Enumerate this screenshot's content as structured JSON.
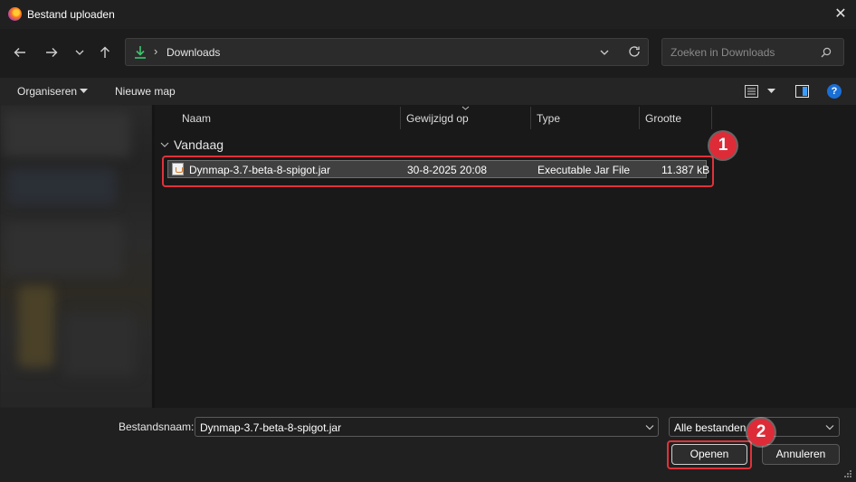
{
  "window": {
    "title": "Bestand uploaden",
    "close_icon": "close-icon",
    "app_icon": "firefox-icon"
  },
  "nav": {
    "back_icon": "arrow-left-icon",
    "forward_icon": "arrow-right-icon",
    "recent_icon": "chevron-down-icon",
    "up_icon": "arrow-up-icon"
  },
  "address": {
    "folder_icon": "download-icon",
    "separator": "›",
    "location": "Downloads"
  },
  "search": {
    "placeholder": "Zoeken in Downloads"
  },
  "toolbar": {
    "organize_label": "Organiseren",
    "new_folder_label": "Nieuwe map"
  },
  "columns": [
    "Naam",
    "Gewijzigd op",
    "Type",
    "Grootte"
  ],
  "group": {
    "label": "Vandaag"
  },
  "files": [
    {
      "name": "Dynmap-3.7-beta-8-spigot.jar",
      "modified": "30-8-2025 20:08",
      "type": "Executable Jar File",
      "size": "11.387 kB"
    }
  ],
  "footer": {
    "filename_label": "Bestandsnaam:",
    "filename_value": "Dynmap-3.7-beta-8-spigot.jar",
    "filter_value": "Alle bestanden",
    "open_label": "Openen",
    "cancel_label": "Annuleren"
  },
  "annotations": {
    "step1": "1",
    "step2": "2"
  },
  "colors": {
    "highlight": "#e0323a",
    "accent_download": "#3ec46d",
    "help_blue": "#1a6fd6"
  }
}
